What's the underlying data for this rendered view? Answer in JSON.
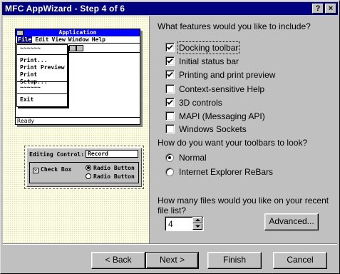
{
  "window": {
    "title": "MFC AppWizard - Step 4 of 6",
    "help_btn": "?",
    "close_btn": "×"
  },
  "illustration": {
    "app_title": "Application",
    "menubar": [
      "File",
      "Edit",
      "View",
      "Window",
      "Help"
    ],
    "file_menu": {
      "top_wavy": "~~~~~~",
      "items": [
        "Print...",
        "Print Preview",
        "Print Setup..."
      ],
      "mid_wavy": "~~~~~~",
      "exit": "Exit"
    },
    "status": "Ready",
    "form": {
      "editing_label": "Editing Control:",
      "editing_value": "Record",
      "checkbox_label": "Check Box",
      "radio1": "Radio Button",
      "radio2": "Radio Button"
    }
  },
  "features": {
    "question": "What features would you like to include?",
    "items": [
      {
        "label": "Docking toolbar",
        "checked": true
      },
      {
        "label": "Initial status bar",
        "checked": true
      },
      {
        "label": "Printing and print preview",
        "checked": true
      },
      {
        "label": "Context-sensitive Help",
        "checked": false
      },
      {
        "label": "3D controls",
        "checked": true
      },
      {
        "label": "MAPI (Messaging API)",
        "checked": false
      },
      {
        "label": "Windows Sockets",
        "checked": false
      }
    ]
  },
  "toolbars": {
    "question": "How do you want your toolbars to look?",
    "options": [
      {
        "label": "Normal",
        "selected": true
      },
      {
        "label": "Internet Explorer ReBars",
        "selected": false
      }
    ]
  },
  "recent": {
    "question": "How many files would you like on your recent file list?",
    "value": "4"
  },
  "buttons": {
    "advanced": "Advanced...",
    "back": "< Back",
    "next": "Next >",
    "finish": "Finish",
    "cancel": "Cancel"
  }
}
